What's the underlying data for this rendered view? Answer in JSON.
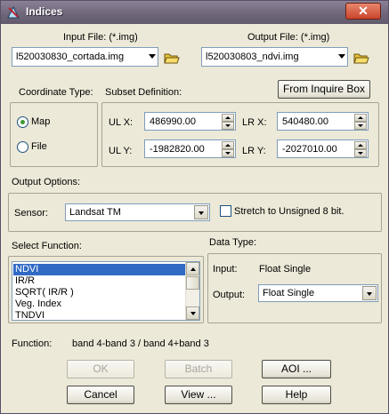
{
  "window": {
    "title": "Indices",
    "close_label": "✕"
  },
  "input_file": {
    "label": "Input File: (*.img)",
    "value": "l520030830_cortada.img"
  },
  "output_file": {
    "label": "Output File: (*.img)",
    "value": "l520030803_ndvi.img"
  },
  "coordinate_type": {
    "label": "Coordinate Type:",
    "options": [
      {
        "label": "Map",
        "selected": true
      },
      {
        "label": "File",
        "selected": false
      }
    ]
  },
  "subset": {
    "label": "Subset Definition:",
    "inquire_button": "From Inquire Box",
    "ulx_label": "UL X:",
    "ulx": "486990.00",
    "uly_label": "UL Y:",
    "uly": "-1982820.00",
    "lrx_label": "LR X:",
    "lrx": "540480.00",
    "lry_label": "LR Y:",
    "lry": "-2027010.00"
  },
  "output_options": {
    "label": "Output Options:",
    "sensor_label": "Sensor:",
    "sensor_value": "Landsat TM",
    "stretch_label": "Stretch to Unsigned 8 bit.",
    "stretch_checked": false
  },
  "select_function": {
    "label": "Select Function:",
    "items": [
      "NDVI",
      "IR/R",
      "SQRT( IR/R )",
      "Veg. Index",
      "TNDVI"
    ],
    "selected": "NDVI"
  },
  "data_type": {
    "label": "Data Type:",
    "input_label": "Input:",
    "input_value": "Float Single",
    "output_label": "Output:",
    "output_value": "Float Single"
  },
  "function": {
    "label": "Function:",
    "value": "band 4-band 3 / band 4+band 3"
  },
  "buttons": {
    "ok": "OK",
    "batch": "Batch",
    "aoi": "AOI ...",
    "cancel": "Cancel",
    "view": "View ...",
    "help": "Help"
  },
  "colors": {
    "titlebar": "#6e6579",
    "dialog_bg": "#ece9d8",
    "selection": "#316ac5"
  }
}
